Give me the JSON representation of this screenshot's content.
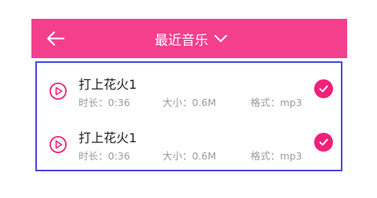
{
  "header": {
    "title": "最近音乐",
    "back_icon": "arrow-left-icon",
    "dropdown_icon": "chevron-down-icon",
    "bg_color": "#f43f8d"
  },
  "songs": [
    {
      "title": "打上花火1",
      "duration": "时长：0:36",
      "size": "大小：0.6M",
      "format": "格式：mp3",
      "selected": true
    },
    {
      "title": "打上花火1",
      "duration": "时长：0:36",
      "size": "大小：0.6M",
      "format": "格式：mp3",
      "selected": true
    }
  ],
  "colors": {
    "accent": "#f0217a",
    "selection_border": "#4a45e0",
    "meta_text": "#9a9a9a"
  }
}
